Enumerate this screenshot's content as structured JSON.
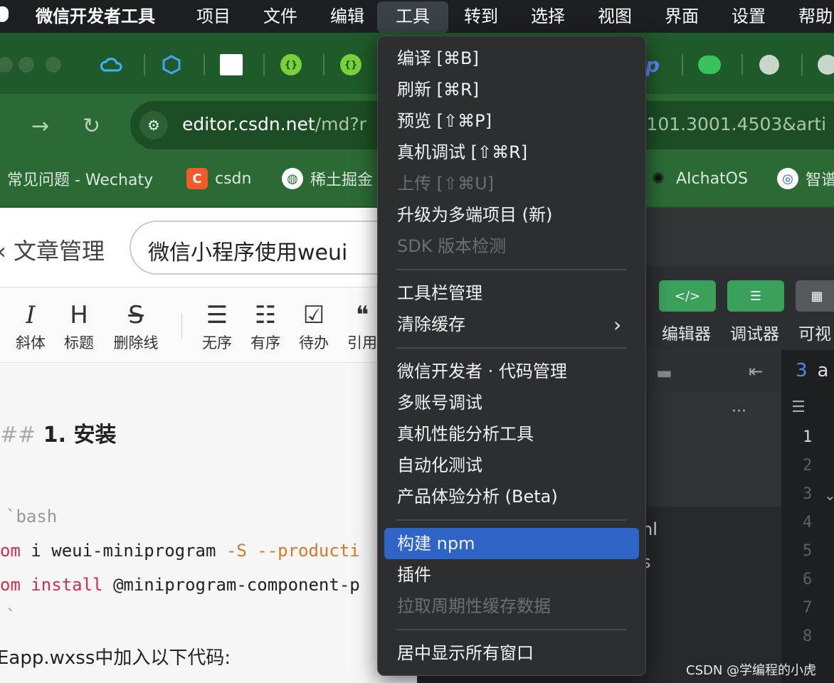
{
  "menubar": {
    "app_name": "微信开发者工具",
    "items": [
      "项目",
      "文件",
      "编辑",
      "工具",
      "转到",
      "选择",
      "视图",
      "界面",
      "设置",
      "帮助"
    ]
  },
  "browser": {
    "url_host": "editor.csdn.net",
    "url_path": "/md?r",
    "url_tail": ":101.3001.4503&arti",
    "bookmarks": [
      "常见问题 - Wechaty",
      "csdn",
      "稀土掘金",
      "AIchatOS",
      "智谱"
    ]
  },
  "editor": {
    "back_label": "文章管理",
    "article_title": "微信小程序使用weui",
    "toolbar": [
      {
        "glyph": "I",
        "label": "斜体"
      },
      {
        "glyph": "H",
        "label": "标题"
      },
      {
        "glyph": "S",
        "label": "删除线"
      },
      {
        "glyph": "☰",
        "label": "无序"
      },
      {
        "glyph": "☷",
        "label": "有序"
      },
      {
        "glyph": "☑",
        "label": "待办"
      },
      {
        "glyph": "❝",
        "label": "引用"
      }
    ],
    "doc": {
      "heading_hash": "##",
      "heading": "1. 安装",
      "fence_open": "`bash",
      "cmd1_prefix": "om",
      "cmd1_main": " i weui-miniprogram ",
      "cmd1_flag": "-S --producti",
      "cmd2_prefix": "om",
      "cmd2_kw": " install",
      "cmd2_main": " @miniprogram-component-p",
      "fence_close": "`",
      "paragraph": "Eapp.wxss中加入以下代码:"
    }
  },
  "devtools": {
    "buttons": [
      "编辑器",
      "调试器",
      "可视"
    ],
    "tab_label": "a",
    "line_numbers": [
      "1",
      "2",
      "3",
      "4",
      "5",
      "6",
      "7",
      "8"
    ],
    "file_frags": [
      "nl",
      "s"
    ],
    "ellipsis": "···"
  },
  "dropdown": {
    "items": [
      {
        "label": "编译 [⌘B]",
        "disabled": false
      },
      {
        "label": "刷新 [⌘R]",
        "disabled": false
      },
      {
        "label": "预览 [⇧⌘P]",
        "disabled": false
      },
      {
        "label": "真机调试 [⇧⌘R]",
        "disabled": false
      },
      {
        "label": "上传 [⇧⌘U]",
        "disabled": true
      },
      {
        "label": "升级为多端项目 (新)",
        "disabled": false
      },
      {
        "label": "SDK 版本检测",
        "disabled": true
      },
      {
        "label": "工具栏管理",
        "disabled": false
      },
      {
        "label": "清除缓存",
        "disabled": false
      },
      {
        "label": "微信开发者 · 代码管理",
        "disabled": false
      },
      {
        "label": "多账号调试",
        "disabled": false
      },
      {
        "label": "真机性能分析工具",
        "disabled": false
      },
      {
        "label": "自动化测试",
        "disabled": false
      },
      {
        "label": "产品体验分析 (Beta)",
        "disabled": false
      },
      {
        "label": "构建 npm",
        "disabled": false,
        "highlighted": true
      },
      {
        "label": "插件",
        "disabled": false
      },
      {
        "label": "拉取周期性缓存数据",
        "disabled": true
      },
      {
        "label": "居中显示所有窗口",
        "disabled": false
      }
    ]
  },
  "watermark": "CSDN @学编程的小虎",
  "colors": {
    "menu_highlight": "#2e64c6",
    "browser_green": "#2b6a35",
    "code_keyword": "#d0304d",
    "code_flag": "#d37a2a"
  }
}
